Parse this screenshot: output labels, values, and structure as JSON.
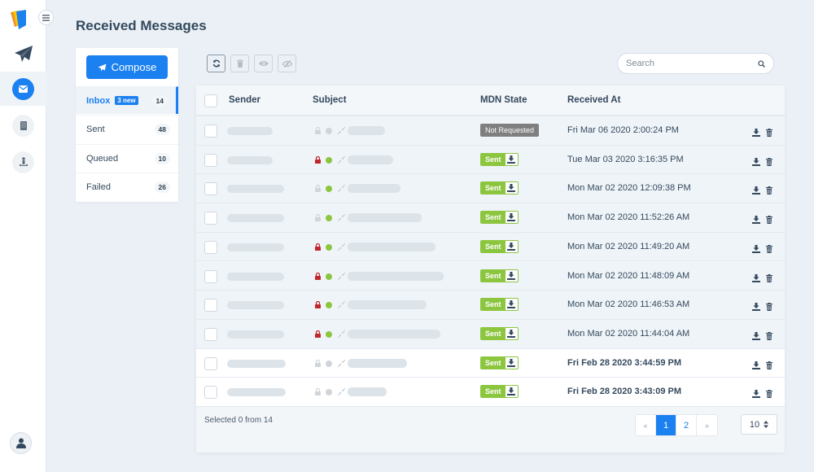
{
  "page": {
    "title": "Received Messages"
  },
  "sidebar": {
    "toggle_icon": "hamburger-icon",
    "items": [
      {
        "name": "send",
        "icon": "paper-plane-icon",
        "active": false
      },
      {
        "name": "received",
        "icon": "envelope-icon",
        "active": true
      },
      {
        "name": "devices",
        "icon": "tablet-icon",
        "active": false
      },
      {
        "name": "partners",
        "icon": "user-anchor-icon",
        "active": false
      }
    ],
    "user_icon": "user-icon"
  },
  "folders": {
    "compose_label": "Compose",
    "items": [
      {
        "label": "Inbox",
        "badge": "3 new",
        "count": "14",
        "active": true
      },
      {
        "label": "Sent",
        "count": "48",
        "active": false
      },
      {
        "label": "Queued",
        "count": "10",
        "active": false
      },
      {
        "label": "Failed",
        "count": "26",
        "active": false
      }
    ]
  },
  "toolbar": {
    "buttons": [
      {
        "name": "refresh",
        "icon": "refresh-icon"
      },
      {
        "name": "delete",
        "icon": "trash-icon"
      },
      {
        "name": "mark-read",
        "icon": "eye-icon"
      },
      {
        "name": "mark-unread",
        "icon": "eye-slash-icon"
      }
    ]
  },
  "search": {
    "placeholder": "Search",
    "value": ""
  },
  "table": {
    "headers": {
      "sender": "Sender",
      "subject": "Subject",
      "mdn": "MDN State",
      "received": "Received At"
    },
    "rows": [
      {
        "encrypted": false,
        "signed": false,
        "mdn": "Not Requested",
        "mdn_type": "grey",
        "received": "Fri Mar 06 2020 2:00:24 PM",
        "unread": false
      },
      {
        "encrypted": true,
        "signed": true,
        "mdn": "Sent",
        "mdn_type": "green",
        "received": "Tue Mar 03 2020 3:16:35 PM",
        "unread": false
      },
      {
        "encrypted": false,
        "signed": true,
        "mdn": "Sent",
        "mdn_type": "green",
        "received": "Mon Mar 02 2020 12:09:38 PM",
        "unread": false
      },
      {
        "encrypted": false,
        "signed": true,
        "mdn": "Sent",
        "mdn_type": "green",
        "received": "Mon Mar 02 2020 11:52:26 AM",
        "unread": false
      },
      {
        "encrypted": true,
        "signed": true,
        "mdn": "Sent",
        "mdn_type": "green",
        "received": "Mon Mar 02 2020 11:49:20 AM",
        "unread": false
      },
      {
        "encrypted": true,
        "signed": true,
        "mdn": "Sent",
        "mdn_type": "green",
        "received": "Mon Mar 02 2020 11:48:09 AM",
        "unread": false
      },
      {
        "encrypted": true,
        "signed": true,
        "mdn": "Sent",
        "mdn_type": "green",
        "received": "Mon Mar 02 2020 11:46:53 AM",
        "unread": false
      },
      {
        "encrypted": true,
        "signed": true,
        "mdn": "Sent",
        "mdn_type": "green",
        "received": "Mon Mar 02 2020 11:44:04 AM",
        "unread": false
      },
      {
        "encrypted": false,
        "signed": false,
        "mdn": "Sent",
        "mdn_type": "green",
        "received": "Fri Feb 28 2020 3:44:59 PM",
        "unread": true
      },
      {
        "encrypted": false,
        "signed": false,
        "mdn": "Sent",
        "mdn_type": "green",
        "received": "Fri Feb 28 2020 3:43:09 PM",
        "unread": true
      }
    ]
  },
  "footer": {
    "selection_text": "Selected 0 from 14",
    "pagination": {
      "prev": "«",
      "pages": [
        "1",
        "2"
      ],
      "current": "1",
      "next": "»"
    },
    "per_page": "10"
  },
  "colors": {
    "accent": "#1b80f0",
    "success": "#8cc63f",
    "danger": "#c0272d",
    "muted": "#7f7f7f"
  }
}
